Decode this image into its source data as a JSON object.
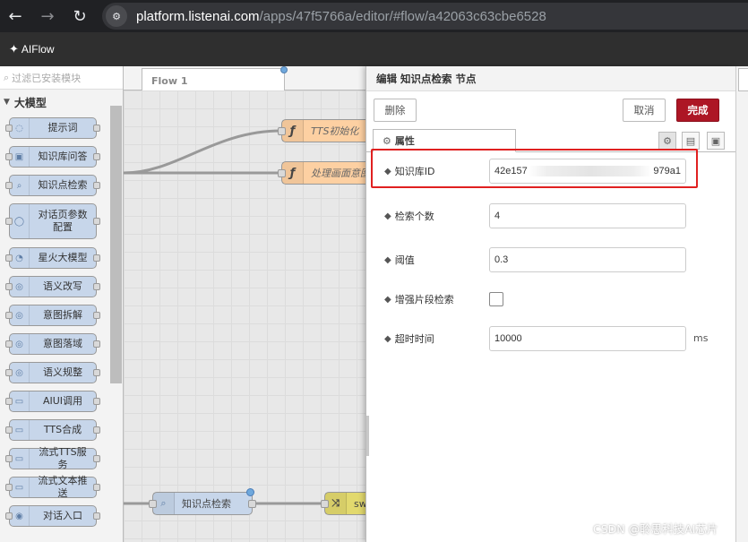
{
  "browser": {
    "url_host": "platform.listenai.com",
    "url_path": "/apps/47f5766a/editor/#flow/a42063c63cbe6528"
  },
  "app": {
    "logo_text": "AIFlow"
  },
  "palette": {
    "search_placeholder": "过滤已安装模块",
    "category": "大模型",
    "nodes": [
      "提示词",
      "知识库问答",
      "知识点检索",
      "对话页参数配置",
      "星火大模型",
      "语义改写",
      "意图拆解",
      "意图落域",
      "语义规整",
      "AIUI调用",
      "TTS合成",
      "流式TTS服务",
      "流式文本推送",
      "对话入口"
    ]
  },
  "workspace": {
    "tab_label": "Flow 1",
    "nodes": {
      "tts_init": "TTS初始化",
      "process_intent": "处理画面意图",
      "knowledge_search": "知识点检索",
      "switch": "sw"
    }
  },
  "tray": {
    "title": "编辑 知识点检索 节点",
    "delete_label": "删除",
    "cancel_label": "取消",
    "done_label": "完成",
    "tab_label": "属性",
    "fields": {
      "kb_id": {
        "label": "知识库ID",
        "value_prefix": "42e157",
        "value_suffix": "979a1"
      },
      "count": {
        "label": "检索个数",
        "value": "4"
      },
      "threshold": {
        "label": "阈值",
        "value": "0.3"
      },
      "enhance": {
        "label": "增强片段检索",
        "checked": false
      },
      "timeout": {
        "label": "超时时间",
        "value": "10000",
        "unit": "ms"
      }
    }
  },
  "watermark": "CSDN @聆思科技AI芯片",
  "colors": {
    "primary_button": "#ad1625",
    "highlight_border": "#e02020",
    "palette_node": "#c7d6ea",
    "function_node": "#fdd0a2"
  }
}
